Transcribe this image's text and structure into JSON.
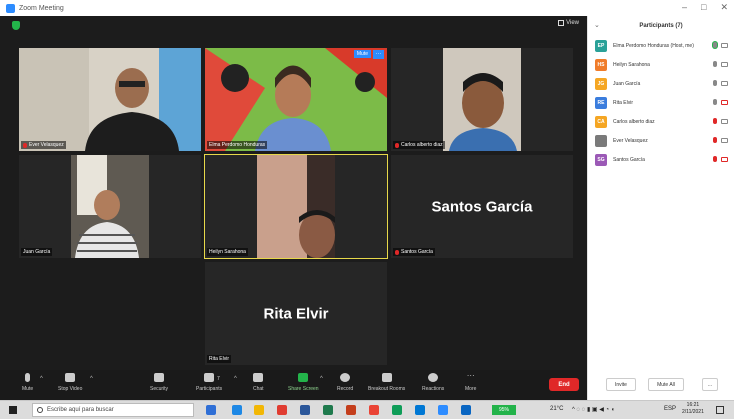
{
  "window": {
    "title": "Zoom Meeting"
  },
  "header": {
    "view_label": "View"
  },
  "tiles": [
    {
      "name": "Ever Velasquez",
      "type": "video",
      "bg": "#d8d2c6"
    },
    {
      "name": "Elma Perdomo Honduras",
      "type": "video",
      "bg": "#7cbb48",
      "mute_label": "Mute"
    },
    {
      "name": "Carlos alberto diaz",
      "type": "video",
      "bg": "#cfc8bd"
    },
    {
      "name": "Juan García",
      "type": "video",
      "bg": "#5f5a52"
    },
    {
      "name": "Heilyn Sarahona",
      "type": "video",
      "bg": "#3a2c28"
    },
    {
      "name": "Santos García",
      "type": "name",
      "display": "Santos García"
    },
    {
      "name": "Rita Elvir",
      "type": "name",
      "display": "Rita Elvir"
    }
  ],
  "toolbar": {
    "mute": "Mute",
    "stop_video": "Stop Video",
    "security": "Security",
    "participants": "Participants",
    "participants_count": "7",
    "chat": "Chat",
    "share_screen": "Share Screen",
    "record": "Record",
    "breakout": "Breakout Rooms",
    "reactions": "Reactions",
    "more": "More",
    "end": "End"
  },
  "panel": {
    "title": "Participants (7)",
    "participants": [
      {
        "initials": "EP",
        "color": "#2aa198",
        "name": "Elma Perdomo Honduras (Host, me)",
        "mic": "active",
        "cam": "on"
      },
      {
        "initials": "HS",
        "color": "#f07c2a",
        "name": "Heilyn Sarahona",
        "mic": "on",
        "cam": "on"
      },
      {
        "initials": "JG",
        "color": "#f5a623",
        "name": "Juan García",
        "mic": "on",
        "cam": "on"
      },
      {
        "initials": "RE",
        "color": "#3b7ddd",
        "name": "Rita Elvir",
        "mic": "on",
        "cam": "off"
      },
      {
        "initials": "CA",
        "color": "#f5a623",
        "name": "Carlos alberto diaz",
        "mic": "off",
        "cam": "on"
      },
      {
        "initials": "",
        "color": "#7a7a7a",
        "name": "Ever Velasquez",
        "mic": "off",
        "cam": "on"
      },
      {
        "initials": "SG",
        "color": "#9b59b6",
        "name": "Santos García",
        "mic": "off",
        "cam": "off"
      }
    ],
    "invite": "Invite",
    "mute_all": "Mute All",
    "more": "..."
  },
  "taskbar": {
    "search_placeholder": "Escribe aquí para buscar",
    "battery": "95%",
    "temperature": "21°C",
    "lang": "ESP",
    "time": "16:21",
    "date": "2/11/2021"
  }
}
